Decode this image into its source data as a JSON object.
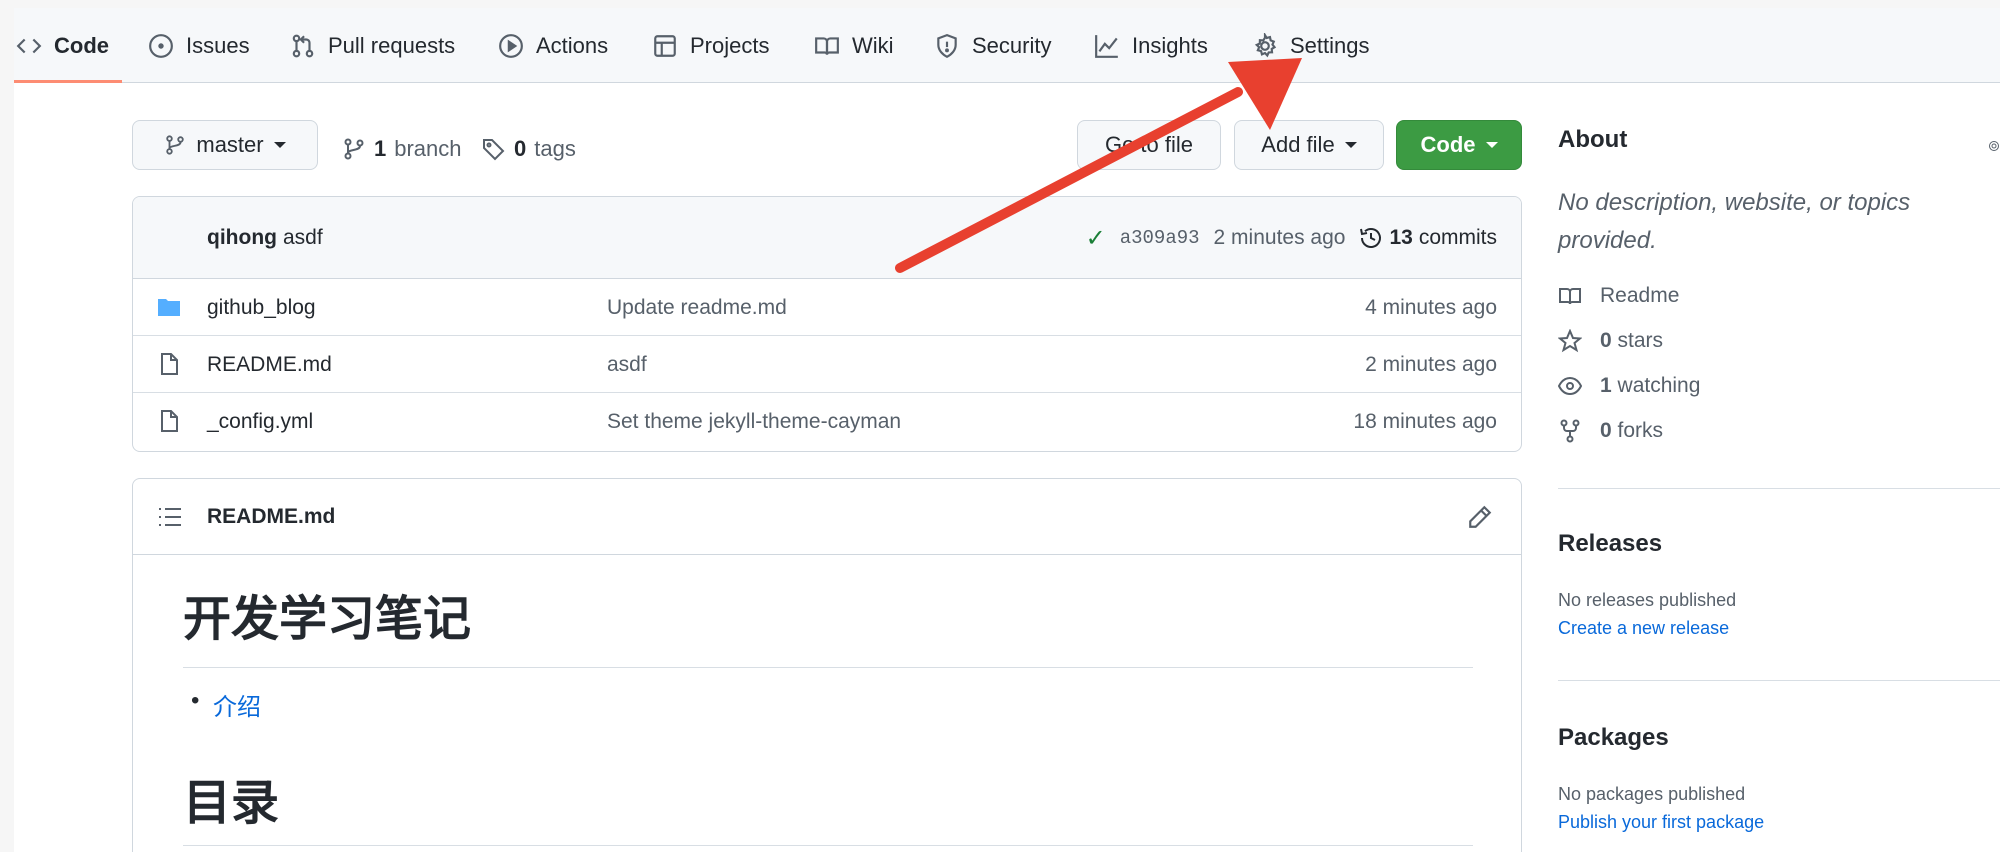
{
  "repo_nav": {
    "items": [
      {
        "label": "Code"
      },
      {
        "label": "Issues"
      },
      {
        "label": "Pull requests"
      },
      {
        "label": "Actions"
      },
      {
        "label": "Projects"
      },
      {
        "label": "Wiki"
      },
      {
        "label": "Security"
      },
      {
        "label": "Insights"
      },
      {
        "label": "Settings"
      }
    ],
    "selected": "Code"
  },
  "branch_bar": {
    "branch": "master",
    "branch_count": "1",
    "branch_label": "branch",
    "tag_count": "0",
    "tag_label": "tags",
    "go_to_file": "Go to file",
    "add_file": "Add file",
    "code_button": "Code"
  },
  "latest_commit": {
    "author": "qihong",
    "message": "asdf",
    "sha": "a309a93",
    "age": "2 minutes ago",
    "commit_count": "13",
    "commits_label": "commits"
  },
  "files": [
    {
      "name": "github_blog",
      "type": "folder",
      "message": "Update readme.md",
      "age": "4 minutes ago"
    },
    {
      "name": "README.md",
      "type": "file",
      "message": "asdf",
      "age": "2 minutes ago"
    },
    {
      "name": "_config.yml",
      "type": "file",
      "message": "Set theme jekyll-theme-cayman",
      "age": "18 minutes ago"
    }
  ],
  "readme": {
    "filename": "README.md",
    "h1": "开发学习笔记",
    "list_item": "介绍",
    "h2": "目录"
  },
  "sidebar": {
    "about_title": "About",
    "about_desc": "No description, website, or topics provided.",
    "readme_label": "Readme",
    "stars_count": "0",
    "stars_label": "stars",
    "watching_count": "1",
    "watching_label": "watching",
    "forks_count": "0",
    "forks_label": "forks",
    "releases_title": "Releases",
    "releases_note": "No releases published",
    "releases_link": "Create a new release",
    "packages_title": "Packages",
    "packages_note": "No packages published",
    "packages_link": "Publish your first package"
  },
  "colors": {
    "accent_underline": "#fd8c73",
    "primary_button": "#3c9b43",
    "link": "#0969da",
    "annotation_arrow": "#e8402f"
  }
}
